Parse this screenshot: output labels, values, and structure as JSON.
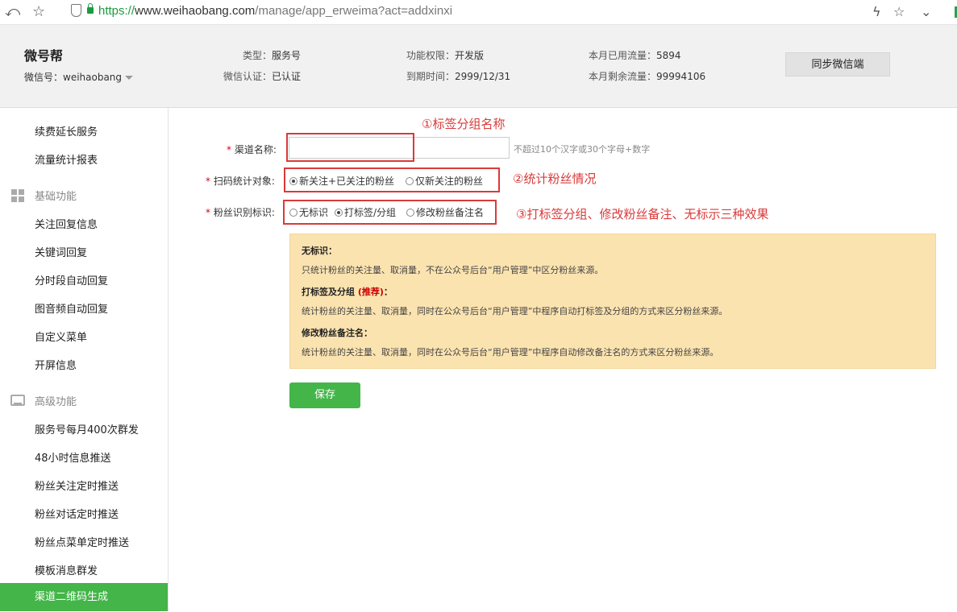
{
  "browser": {
    "url_scheme": "https://",
    "url_host": "www.weihaobang.com",
    "url_path": "/manage/app_erweima?act=addxinxi",
    "icons": [
      "back-icon",
      "star-icon",
      "shield-icon",
      "lock-icon",
      "flash-icon",
      "bookmark-star-icon",
      "chevron-down-icon"
    ]
  },
  "header": {
    "brand": "微号帮",
    "account": "微信号：weihaobang",
    "type_label": "类型：",
    "type_value": "服务号",
    "auth_label": "微信认证：",
    "auth_value": "已认证",
    "perm_label": "功能权限：",
    "perm_value": "开发版",
    "expire_label": "到期时间：",
    "expire_value": "2999/12/31",
    "used_label": "本月已用流量：",
    "used_value": "5894",
    "remain_label": "本月剩余流量：",
    "remain_value": "99994106",
    "sync_button": "同步微信端"
  },
  "sidebar": {
    "top_items": [
      "续费延长服务",
      "流量统计报表"
    ],
    "basic_group": "基础功能",
    "basic_items": [
      "关注回复信息",
      "关键词回复",
      "分时段自动回复",
      "图音频自动回复",
      "自定义菜单",
      "开屏信息"
    ],
    "advanced_group": "高级功能",
    "advanced_items": [
      "服务号每月400次群发",
      "48小时信息推送",
      "粉丝关注定时推送",
      "粉丝对话定时推送",
      "粉丝点菜单定时推送",
      "模板消息群发"
    ],
    "active_item": "渠道二维码生成"
  },
  "form": {
    "required_mark": "*",
    "channel_label": "渠道名称:",
    "channel_value": "",
    "channel_hint": "不超过10个汉字或30个字母+数字",
    "scan_label": "扫码统计对象:",
    "scan_options": [
      "新关注+已关注的粉丝",
      "仅新关注的粉丝"
    ],
    "scan_selected": 0,
    "mark_label": "粉丝识别标识:",
    "mark_options": [
      "无标识",
      "打标签/分组",
      "修改粉丝备注名"
    ],
    "mark_selected": 1
  },
  "annotations": {
    "a1": "①标签分组名称",
    "a2": "②统计粉丝情况",
    "a3": "③打标签分组、修改粉丝备注、无标示三种效果"
  },
  "tips": {
    "h1": "无标识：",
    "t1": "只统计粉丝的关注量、取消量，不在公众号后台“用户管理”中区分粉丝来源。",
    "h2": "打标签及分组",
    "h2_red": "(推荐)",
    "h2_tail": "：",
    "t2": "统计粉丝的关注量、取消量，同时在公众号后台“用户管理”中程序自动打标签及分组的方式来区分粉丝来源。",
    "h3": "修改粉丝备注名：",
    "t3": "统计粉丝的关注量、取消量，同时在公众号后台“用户管理”中程序自动修改备注名的方式来区分粉丝来源。"
  },
  "save_button": "保存",
  "colors": {
    "accent": "#44b549",
    "annotation": "#d93a3a",
    "tip_bg": "#fbe3b0"
  }
}
